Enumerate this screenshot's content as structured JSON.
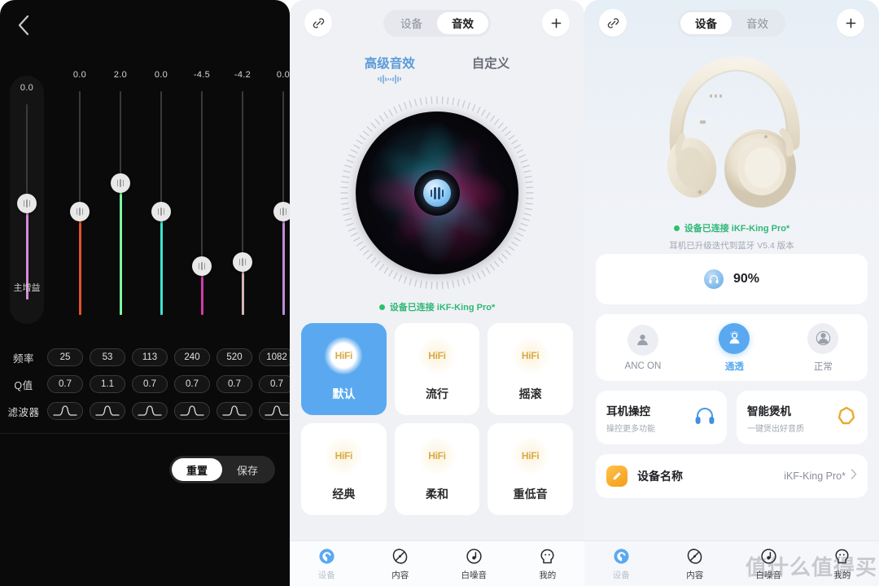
{
  "eq": {
    "back_icon": "chevron-left-icon",
    "master": {
      "value": "0.0",
      "label": "主增益",
      "color": "#d88ae0"
    },
    "bands": [
      {
        "value": "0.0",
        "color": "#e2512a"
      },
      {
        "value": "2.0",
        "color": "#7dfaa3"
      },
      {
        "value": "0.0",
        "color": "#3fe0cf"
      },
      {
        "value": "-4.5",
        "color": "#d13aa8"
      },
      {
        "value": "-4.2",
        "color": "#d9b3b0"
      },
      {
        "value": "0.0",
        "color": "#c08ad8"
      }
    ],
    "rows": {
      "freq_label": "频率",
      "freq_values": [
        "25",
        "53",
        "113",
        "240",
        "520",
        "1082"
      ],
      "q_label": "Q值",
      "q_values": [
        "0.7",
        "1.1",
        "0.7",
        "0.7",
        "0.7",
        "0.7"
      ],
      "filter_label": "滤波器",
      "filter_icon": "bell-filter-icon"
    },
    "actions": {
      "reset": "重置",
      "save": "保存"
    }
  },
  "fx": {
    "link_icon": "link-icon",
    "add_icon": "plus-icon",
    "segments": [
      {
        "label": "设备",
        "active": false
      },
      {
        "label": "音效",
        "active": true
      }
    ],
    "tabs": [
      {
        "label": "高级音效",
        "active": true
      },
      {
        "label": "自定义",
        "active": false
      }
    ],
    "visualizer_icon": "hifi-wave-icon",
    "connection": "设备已连接 iKF-King Pro*",
    "presets": [
      {
        "name": "默认",
        "badge": "HiFi",
        "active": true
      },
      {
        "name": "流行",
        "badge": "HiFi",
        "active": false
      },
      {
        "name": "摇滚",
        "badge": "HiFi",
        "active": false
      },
      {
        "name": "经典",
        "badge": "HiFi",
        "active": false
      },
      {
        "name": "柔和",
        "badge": "HiFi",
        "active": false
      },
      {
        "name": "重低音",
        "badge": "HiFi",
        "active": false
      }
    ],
    "tabbar": [
      {
        "label": "设备",
        "icon": "device-icon",
        "active": true
      },
      {
        "label": "内容",
        "icon": "content-icon",
        "active": false
      },
      {
        "label": "白噪音",
        "icon": "whitenoise-icon",
        "active": false
      },
      {
        "label": "我的",
        "icon": "profile-icon",
        "active": false
      }
    ]
  },
  "device": {
    "link_icon": "link-icon",
    "add_icon": "plus-icon",
    "segments": [
      {
        "label": "设备",
        "active": true
      },
      {
        "label": "音效",
        "active": false
      }
    ],
    "product_image": "over-ear-headphones-beige",
    "status_connected": "设备已连接 iKF-King Pro*",
    "status_firmware": "耳机已升级迭代到蓝牙 V5.4 版本",
    "battery": {
      "icon": "headphone-icon",
      "percent": "90%"
    },
    "anc_modes": [
      {
        "label": "ANC ON",
        "icon": "person-solid-icon",
        "active": false
      },
      {
        "label": "通透",
        "icon": "person-waves-icon",
        "active": true
      },
      {
        "label": "正常",
        "icon": "person-circle-icon",
        "active": false
      }
    ],
    "features": [
      {
        "title": "耳机操控",
        "subtitle": "操控更多功能",
        "icon": "headphone-blue-icon"
      },
      {
        "title": "智能煲机",
        "subtitle": "一键煲出好音质",
        "icon": "burn-in-ring-icon"
      }
    ],
    "device_name": {
      "icon": "pencil-icon",
      "label": "设备名称",
      "value": "iKF-King Pro*",
      "chevron": "chevron-right-icon"
    },
    "tabbar": [
      {
        "label": "设备",
        "icon": "device-icon",
        "active": true
      },
      {
        "label": "内容",
        "icon": "content-icon",
        "active": false
      },
      {
        "label": "白噪音",
        "icon": "whitenoise-icon",
        "active": false
      },
      {
        "label": "我的",
        "icon": "profile-icon",
        "active": false
      }
    ],
    "watermark": "值什么值得买"
  },
  "colors": {
    "accent_blue": "#5aa9f0",
    "tab_blue": "#5a9bd8",
    "green": "#2fb877",
    "gold": "#d8ab48"
  }
}
